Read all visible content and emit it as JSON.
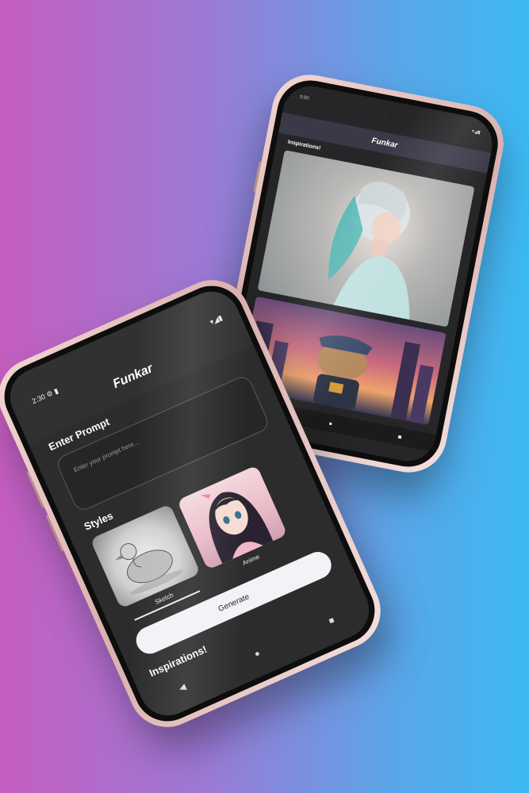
{
  "app": {
    "title": "Funkar"
  },
  "back_phone": {
    "status_time": "5:50",
    "status_icons": "▾◢▮",
    "section_label": "Inspirations!",
    "nav": {
      "back": "◀",
      "home": "●",
      "recents": "■"
    }
  },
  "front_phone": {
    "status_time": "2:30",
    "status_left_icons": "⚙ ▮",
    "status_right_icons": "▾◢▮",
    "prompt": {
      "heading": "Enter Prompt",
      "placeholder": "Enter your prompt here..."
    },
    "styles": {
      "heading": "Styles",
      "items": [
        {
          "label": "Sketch"
        },
        {
          "label": "Anime"
        }
      ]
    },
    "generate_label": "Generate",
    "inspirations_heading": "Inspirations!",
    "nav": {
      "back": "◀",
      "home": "●",
      "recents": "■"
    }
  }
}
